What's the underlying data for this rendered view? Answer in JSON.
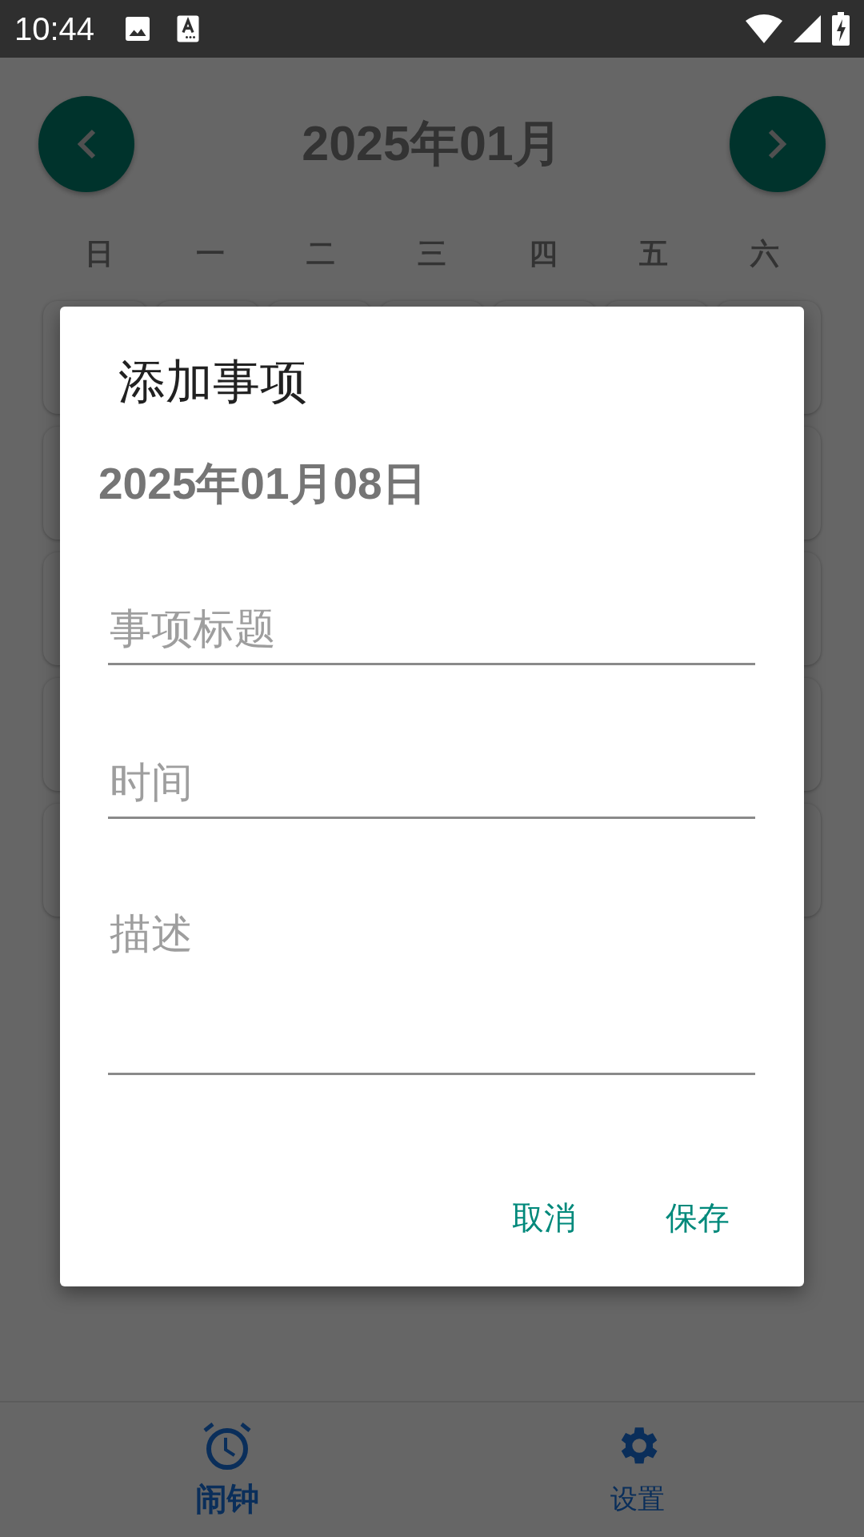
{
  "status_bar": {
    "time": "10:44"
  },
  "calendar": {
    "title": "2025年01月",
    "weekdays": [
      "日",
      "一",
      "二",
      "三",
      "四",
      "五",
      "六"
    ]
  },
  "dialog": {
    "title": "添加事项",
    "date": "2025年01月08日",
    "fields": [
      {
        "kind": "line",
        "placeholder": "事项标题"
      },
      {
        "kind": "line",
        "placeholder": "时间"
      },
      {
        "kind": "multiline",
        "placeholder": "描述"
      }
    ],
    "buttons": [
      "取消",
      "保存"
    ]
  },
  "bottom_nav": [
    {
      "label": "闹钟",
      "selected": true
    },
    {
      "label": "设置",
      "selected": false
    }
  ]
}
